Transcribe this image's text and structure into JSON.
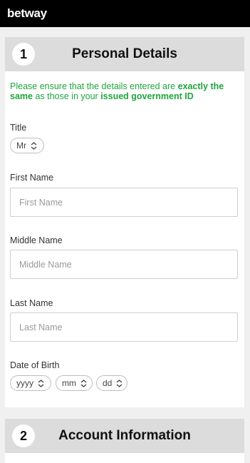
{
  "app": {
    "logo": "betway"
  },
  "personal": {
    "step": "1",
    "title": "Personal Details",
    "notice": {
      "part1": "Please ensure that the details entered are ",
      "bold1": "exactly the same",
      "part2": " as those in your ",
      "bold2": "issued government ID"
    },
    "title_field": {
      "label": "Title",
      "value": "Mr"
    },
    "first_name": {
      "label": "First Name",
      "placeholder": "First Name"
    },
    "middle_name": {
      "label": "Middle Name",
      "placeholder": "Middle Name"
    },
    "last_name": {
      "label": "Last Name",
      "placeholder": "Last Name"
    },
    "dob": {
      "label": "Date of Birth",
      "year": "yyyy",
      "month": "mm",
      "day": "dd"
    }
  },
  "account": {
    "step": "2",
    "title": "Account Information"
  },
  "colors": {
    "accent_green": "#1fa53c",
    "topbar": "#000000",
    "header_gray": "#dcdcdc"
  },
  "icons": {
    "select_chevron": "chevron-up-down-icon"
  }
}
